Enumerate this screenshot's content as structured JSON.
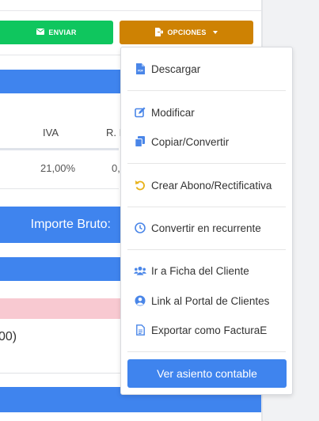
{
  "toolbar": {
    "enviar_label": "ENVIAR",
    "opciones_label": "OPCIONES"
  },
  "table": {
    "headers": [
      "IVA",
      "R. I"
    ],
    "row": [
      "21,00%",
      "0,"
    ]
  },
  "summary": {
    "importe_bruto_label": "Importe Bruto:",
    "partial_value": "00)"
  },
  "dropdown": {
    "items": [
      {
        "label": "Descargar",
        "icon": "pdf-file-icon"
      },
      {
        "label": "Modificar",
        "icon": "edit-icon"
      },
      {
        "label": "Copiar/Convertir",
        "icon": "copy-icon"
      },
      {
        "label": "Crear Abono/Rectificativa",
        "icon": "undo-icon"
      },
      {
        "label": "Convertir en recurrente",
        "icon": "clock-icon"
      },
      {
        "label": "Ir a Ficha del Cliente",
        "icon": "users-icon"
      },
      {
        "label": "Link al Portal de Clientes",
        "icon": "user-circle-icon"
      },
      {
        "label": "Exportar como FacturaE",
        "icon": "file-text-icon"
      }
    ],
    "action_label": "Ver asiento contable"
  },
  "colors": {
    "primary": "#3f84ee",
    "success": "#0fc65e",
    "warning": "#ce8203",
    "danger_light": "#f8c9d1"
  }
}
